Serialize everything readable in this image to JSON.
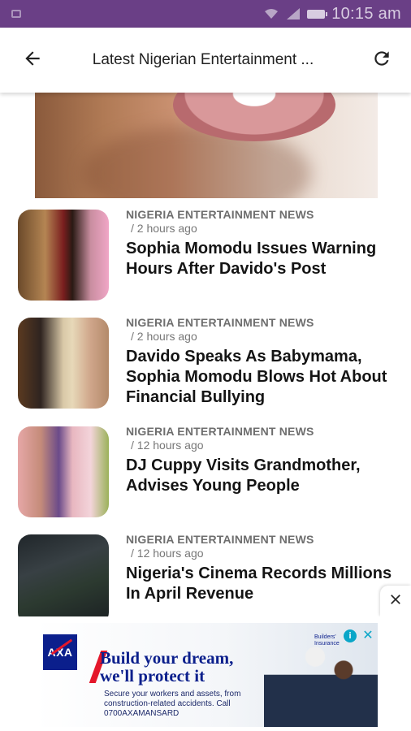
{
  "status_bar": {
    "time": "10:15 am",
    "background_color": "#6a3f86"
  },
  "app_bar": {
    "title": "Latest Nigerian Entertainment ...",
    "back_icon": "arrow-left-icon",
    "refresh_icon": "refresh-icon"
  },
  "articles": [
    {
      "category": "NIGERIA ENTERTAINMENT NEWS",
      "time": "/  2 hours ago",
      "headline": "Sophia Momodu Issues Warning Hours After Davido's Post"
    },
    {
      "category": "NIGERIA ENTERTAINMENT NEWS",
      "time": "/  2 hours ago",
      "headline": "Davido Speaks As Babymama, Sophia Momodu Blows Hot About Financial Bullying"
    },
    {
      "category": "NIGERIA ENTERTAINMENT NEWS",
      "time": "/  12 hours ago",
      "headline": "DJ Cuppy Visits Grandmother, Advises Young People"
    },
    {
      "category": "NIGERIA ENTERTAINMENT NEWS",
      "time": "/  12 hours ago",
      "headline": "Nigeria's Cinema Records Millions In April Revenue"
    }
  ],
  "ad": {
    "logo_text": "AXA",
    "headline_line1": "Build your dream,",
    "headline_line2": "we'll protect it",
    "subtext": "Secure your workers and assets, from construction-related accidents. Call 0700AXAMANSARD",
    "brand_tag": "Builders' Insurance",
    "info_label": "i",
    "close_label": "✕",
    "brand_color": "#0b1f8c",
    "accent_color": "#e4172b"
  }
}
